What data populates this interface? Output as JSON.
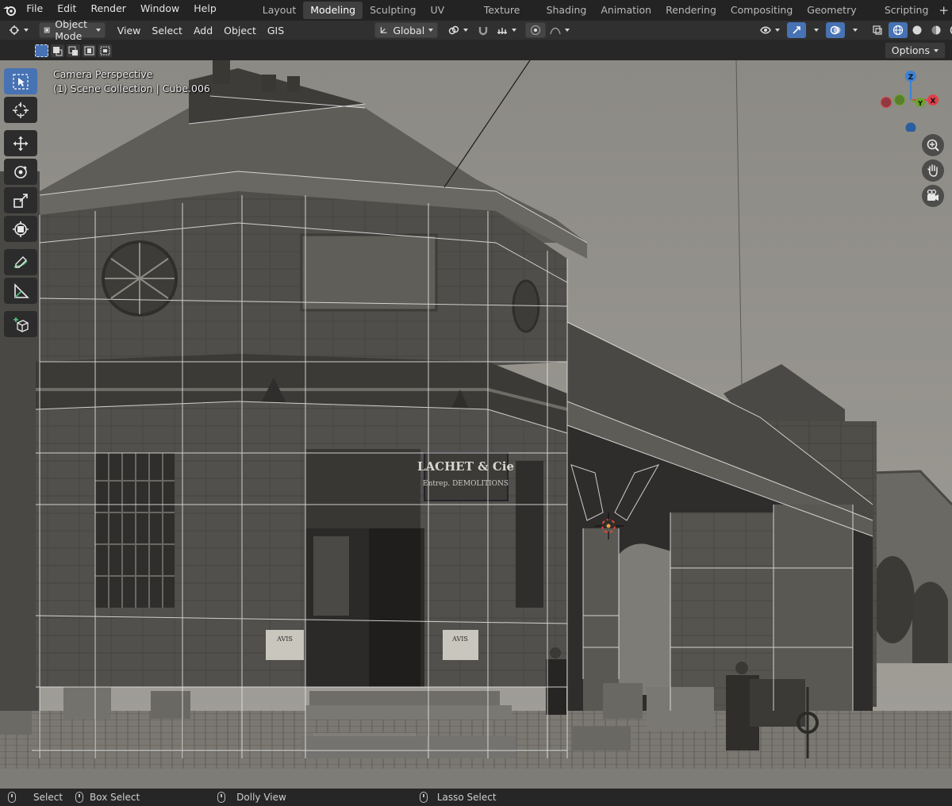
{
  "menu": {
    "items": [
      "File",
      "Edit",
      "Render",
      "Window",
      "Help"
    ]
  },
  "workspaces": {
    "tabs": [
      "Layout",
      "Modeling",
      "Sculpting",
      "UV Editing",
      "Texture Paint",
      "Shading",
      "Animation",
      "Rendering",
      "Compositing",
      "Geometry Nodes",
      "Scripting"
    ],
    "active": "Modeling",
    "add_label": "+"
  },
  "header": {
    "mode_label": "Object Mode",
    "menus": [
      "View",
      "Select",
      "Add",
      "Object",
      "GIS"
    ],
    "orientation_label": "Global"
  },
  "subheader": {
    "options_label": "Options"
  },
  "viewport": {
    "view_name": "Camera Perspective",
    "collection_info": "(1) Scene Collection | Cube.006"
  },
  "gizmo": {
    "z_label": "Z",
    "x_label": "X",
    "y_label": "Y",
    "colors": {
      "x": "#e0404a",
      "y": "#6aa32a",
      "z": "#3a82d6"
    }
  },
  "status": {
    "select": "Select",
    "box_select": "Box Select",
    "dolly": "Dolly View",
    "lasso": "Lasso Select"
  },
  "photo": {
    "sign_main": "LACHET & Cie",
    "sign_sub": "Entrep. DEMOLITIONS",
    "notice_label": "AVIS"
  }
}
